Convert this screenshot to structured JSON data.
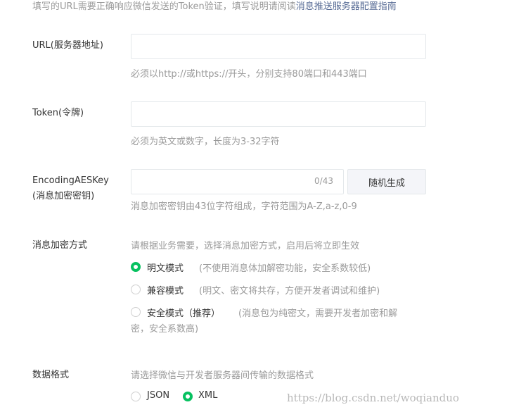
{
  "intro": {
    "text": "填写的URL需要正确响应微信发送的Token验证，填写说明请阅读",
    "link": "消息推送服务器配置指南"
  },
  "url": {
    "label": "URL(服务器地址)",
    "value": "",
    "hint": "必须以http://或https://开头，分别支持80端口和443端口"
  },
  "token": {
    "label": "Token(令牌)",
    "value": "",
    "hint": "必须为英文或数字，长度为3-32字符"
  },
  "aeskey": {
    "label_line1": "EncodingAESKey",
    "label_line2": "(消息加密密钥)",
    "value": "",
    "counter": "0/43",
    "generate_button": "随机生成",
    "hint": "消息加密密钥由43位字符组成，字符范围为A-Z,a-z,0-9"
  },
  "encryption": {
    "label": "消息加密方式",
    "hint": "请根据业务需要，选择消息加密方式，启用后将立即生效",
    "options": [
      {
        "label": "明文模式",
        "desc": "(不使用消息体加解密功能，安全系数较低)",
        "checked": true
      },
      {
        "label": "兼容模式",
        "desc": "(明文、密文将共存，方便开发者调试和维护)",
        "checked": false
      },
      {
        "label": "安全模式（推荐）",
        "desc_line1": "(消息包为纯密文，需要开发者加密和解",
        "desc_line2": "密，安全系数高)",
        "checked": false
      }
    ]
  },
  "format": {
    "label": "数据格式",
    "hint": "请选择微信与开发者服务器间传输的数据格式",
    "options": [
      {
        "label": "JSON",
        "checked": false
      },
      {
        "label": "XML",
        "checked": true
      }
    ]
  },
  "watermark": "https://blog.csdn.net/woqianduo",
  "colors": {
    "accent": "#07c160",
    "link": "#576b95",
    "muted": "#9a9a9a",
    "border": "#e4e8eb"
  }
}
